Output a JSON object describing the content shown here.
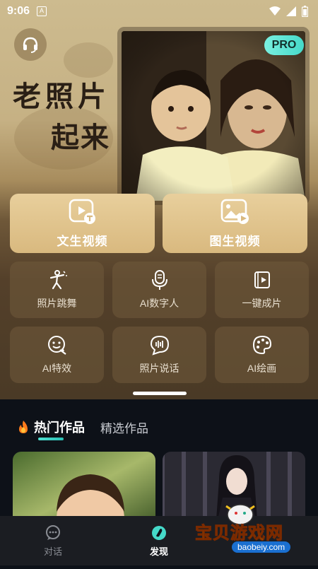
{
  "status_bar": {
    "time": "9:06",
    "notification_badge": "A"
  },
  "hero": {
    "title_line1": "老照片",
    "title_line2": "起来",
    "pro_badge": "PRO"
  },
  "primary_actions": [
    {
      "label": "文生视频",
      "icon": "text-to-video-icon"
    },
    {
      "label": "图生视频",
      "icon": "image-to-video-icon"
    }
  ],
  "tools": [
    {
      "label": "照片跳舞",
      "icon": "dance-icon"
    },
    {
      "label": "AI数字人",
      "icon": "microphone-icon"
    },
    {
      "label": "一键成片",
      "icon": "video-book-icon"
    },
    {
      "label": "AI特效",
      "icon": "effect-face-icon"
    },
    {
      "label": "照片说话",
      "icon": "talking-icon"
    },
    {
      "label": "AI绘画",
      "icon": "palette-icon"
    }
  ],
  "feed": {
    "tab_hot": "热门作品",
    "tab_selected": "精选作品",
    "hot_icon": "fire-icon"
  },
  "bottom_nav": [
    {
      "label": "对话",
      "icon": "chat-icon",
      "active": false
    },
    {
      "label": "发现",
      "icon": "discover-icon",
      "active": true
    }
  ],
  "watermark": {
    "title": "宝贝游戏网",
    "url": "baobeiy.com"
  },
  "colors": {
    "accent": "#45d9c9",
    "card_gold": "#d9b97f",
    "background": "#0d1118"
  }
}
